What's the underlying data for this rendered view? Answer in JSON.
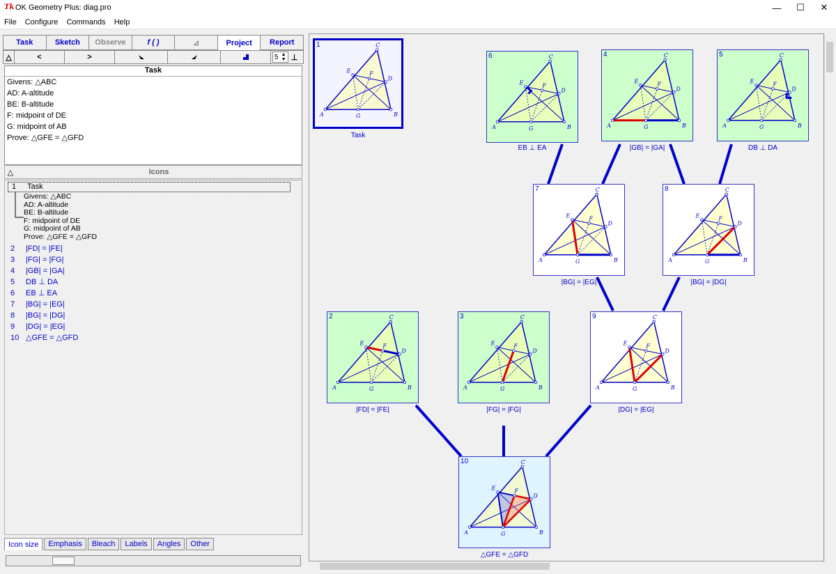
{
  "window": {
    "title": "OK Geometry Plus: diag.pro",
    "app_icon": "Tk",
    "minimize": "—",
    "maximize": "☐",
    "close": "✕"
  },
  "menu": [
    "File",
    "Configure",
    "Commands",
    "Help"
  ],
  "tabs": [
    "Task",
    "Sketch",
    "Observe",
    "f ( )",
    "⊿",
    "Project",
    "Report"
  ],
  "nav": {
    "triangle": "△",
    "prev": "<",
    "next": ">",
    "zoom": "5",
    "pin": "⊥"
  },
  "task": {
    "header": "Task",
    "lines": [
      "Givens: △ABC",
      "AD: A-altitude",
      "BE: B-altitude",
      "F: midpoint of DE",
      "G: midpoint of AB",
      "Prove: △GFE = △GFD"
    ]
  },
  "icons_header": {
    "toggle": "△",
    "title": "Icons"
  },
  "list": {
    "first": {
      "num": "1",
      "label": "Task"
    },
    "sub": [
      "Givens: △ABC",
      "AD: A-altitude",
      "BE: B-altitude",
      "F: midpoint of DE",
      "G: midpoint of AB",
      "Prove: △GFE = △GFD"
    ],
    "items": [
      {
        "num": "2",
        "label": "|FD| = |FE|"
      },
      {
        "num": "3",
        "label": "|FG| = |FG|"
      },
      {
        "num": "4",
        "label": "|GB| = |GA|"
      },
      {
        "num": "5",
        "label": "DB ⊥ DA"
      },
      {
        "num": "6",
        "label": "EB ⊥ EA"
      },
      {
        "num": "7",
        "label": "|BG| = |EG|"
      },
      {
        "num": "8",
        "label": "|BG| = |DG|"
      },
      {
        "num": "9",
        "label": "|DG| = |EG|"
      },
      {
        "num": "10",
        "label": "△GFE = △GFD"
      }
    ]
  },
  "bottom_tabs": [
    "Icon size",
    "Emphasis",
    "Bleach",
    "Labels",
    "Angles",
    "Other"
  ],
  "colors": {
    "accent": "#0000cc",
    "green_bg": "#ccffcc",
    "blue_bg": "#e0f4ff",
    "red": "#dd0000"
  },
  "points": [
    "A",
    "B",
    "C",
    "D",
    "E",
    "F",
    "G"
  ],
  "cards": [
    {
      "num": "1",
      "caption": "Task"
    },
    {
      "num": "6",
      "caption": "EB ⊥ EA"
    },
    {
      "num": "4",
      "caption": "|GB| = |GA|"
    },
    {
      "num": "5",
      "caption": "DB ⊥ DA"
    },
    {
      "num": "7",
      "caption": "|BG| = |EG|"
    },
    {
      "num": "8",
      "caption": "|BG| = |DG|"
    },
    {
      "num": "2",
      "caption": "|FD| = |FE|"
    },
    {
      "num": "3",
      "caption": "|FG| = |FG|"
    },
    {
      "num": "9",
      "caption": "|DG| = |EG|"
    },
    {
      "num": "10",
      "caption": "△GFE = △GFD"
    }
  ]
}
